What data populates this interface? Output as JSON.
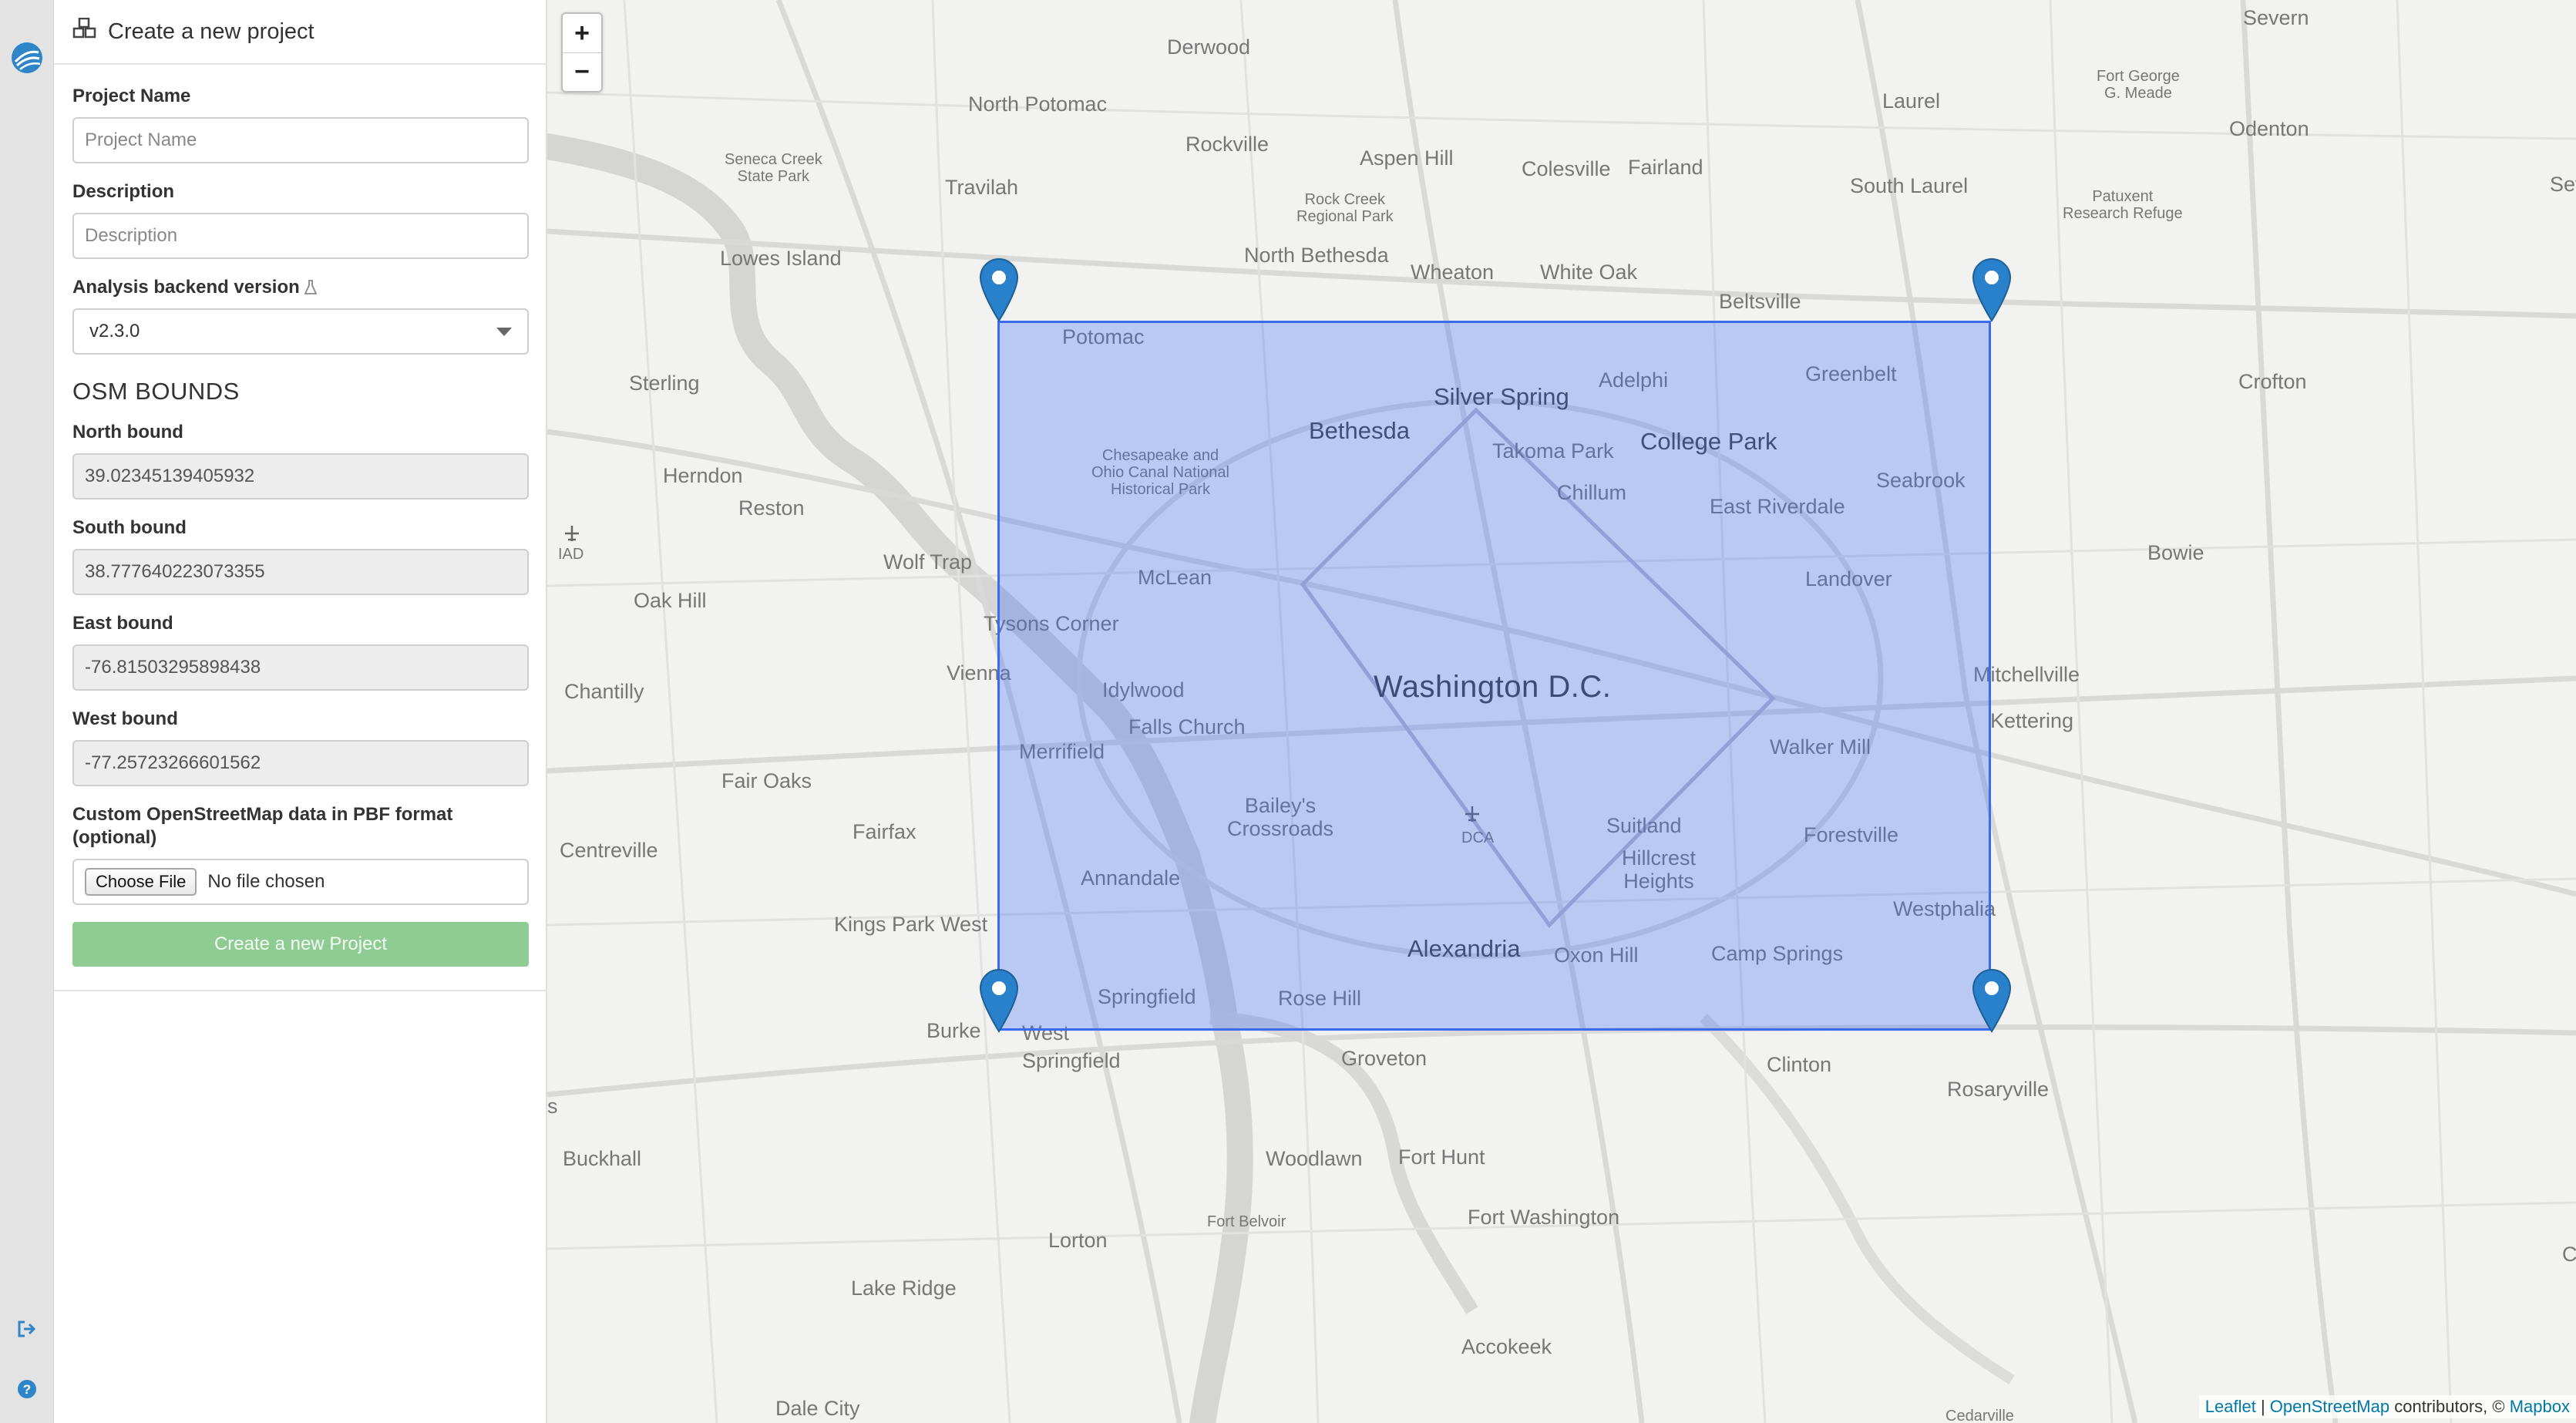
{
  "nav": {
    "logo_icon": "globe-logo-icon",
    "logout_icon": "sign-out-icon",
    "help_icon": "question-circle-icon"
  },
  "panel": {
    "header_icon": "cubes-icon",
    "title": "Create a new project",
    "project_name": {
      "label": "Project Name",
      "placeholder": "Project Name",
      "value": ""
    },
    "description": {
      "label": "Description",
      "placeholder": "Description",
      "value": ""
    },
    "backend_version": {
      "label": "Analysis backend version",
      "icon": "flask-icon",
      "selected": "v2.3.0"
    },
    "bounds_title": "OSM BOUNDS",
    "north": {
      "label": "North bound",
      "value": "39.02345139405932"
    },
    "south": {
      "label": "South bound",
      "value": "38.777640223073355"
    },
    "east": {
      "label": "East bound",
      "value": "-76.81503295898438"
    },
    "west": {
      "label": "West bound",
      "value": "-77.25723266601562"
    },
    "custom_osm": {
      "label": "Custom OpenStreetMap data in PBF format (optional)",
      "button": "Choose File",
      "status": "No file chosen"
    },
    "submit": "Create a new Project"
  },
  "map": {
    "zoom_in": "+",
    "zoom_out": "−",
    "airport_icon": "airplane-icon",
    "marker_icon": "map-marker-icon",
    "selection_color": "#3866ff",
    "marker_color": "#2a81cb",
    "labels": {
      "severn": "Severn",
      "derwood": "Derwood",
      "north_potomac": "North Potomac",
      "rockville": "Rockville",
      "laurel": "Laurel",
      "fort_meade": "Fort George\nG. Meade",
      "odenton": "Odenton",
      "seneca": "Seneca Creek\nState Park",
      "travilah": "Travilah",
      "aspen_hill": "Aspen Hill",
      "colesville": "Colesville",
      "fairland": "Fairland",
      "south_laurel": "South Laurel",
      "patuxent": "Patuxent\nResearch Refuge",
      "rock_creek": "Rock Creek\nRegional Park",
      "seve": "Seve",
      "lowes_island": "Lowes Island",
      "north_bethesda": "North Bethesda",
      "wheaton": "Wheaton",
      "white_oak": "White Oak",
      "beltsville": "Beltsville",
      "potomac": "Potomac",
      "sterling": "Sterling",
      "adelphi": "Adelphi",
      "greenbelt": "Greenbelt",
      "crofton": "Crofton",
      "silver_spring": "Silver Spring",
      "bethesda": "Bethesda",
      "takoma_park": "Takoma Park",
      "college_park": "College Park",
      "chesapeake": "Chesapeake and\nOhio Canal National\nHistorical Park",
      "herndon": "Herndon",
      "seabrook": "Seabrook",
      "chillum": "Chillum",
      "reston": "Reston",
      "east_riverdale": "East Riverdale",
      "bowie": "Bowie",
      "iad": "IAD",
      "wolf_trap": "Wolf Trap",
      "mclean": "McLean",
      "landover": "Landover",
      "oak_hill": "Oak Hill",
      "tysons": "Tysons Corner",
      "vienna": "Vienna",
      "mitchellville": "Mitchellville",
      "chantilly": "Chantilly",
      "idylwood": "Idylwood",
      "washington": "Washington D.C.",
      "kettering": "Kettering",
      "falls_church": "Falls Church",
      "merrifield": "Merrifield",
      "walker_mill": "Walker Mill",
      "fair_oaks": "Fair Oaks",
      "baileys": "Bailey's\nCrossroads",
      "dca": "DCA",
      "suitland": "Suitland",
      "fairfax": "Fairfax",
      "forestville": "Forestville",
      "centreville": "Centreville",
      "hillcrest": "Hillcrest\nHeights",
      "annandale": "Annandale",
      "westphalia": "Westphalia",
      "kings_park": "Kings Park West",
      "alexandria": "Alexandria",
      "oxon_hill": "Oxon Hill",
      "camp_springs": "Camp Springs",
      "springfield": "Springfield",
      "rose_hill": "Rose Hill",
      "burke": "Burke",
      "west_springfield": "West\nSpringfield",
      "groveton": "Groveton",
      "clinton": "Clinton",
      "rosaryville": "Rosaryville",
      "s_edge": "s",
      "buckhall": "Buckhall",
      "woodlawn": "Woodlawn",
      "fort_hunt": "Fort Hunt",
      "fort_belvoir": "Fort Belvoir",
      "fort_washington": "Fort Washington",
      "lorton": "Lorton",
      "lake_ridge": "Lake Ridge",
      "accokeek": "Accokeek",
      "dale_city": "Dale City",
      "cedarville": "Cedarville",
      "c_edge": "C"
    },
    "attribution": {
      "leaflet": "Leaflet",
      "sep": " | ",
      "osm": "OpenStreetMap",
      "contrib": " contributors, © ",
      "mapbox": "Mapbox"
    }
  }
}
